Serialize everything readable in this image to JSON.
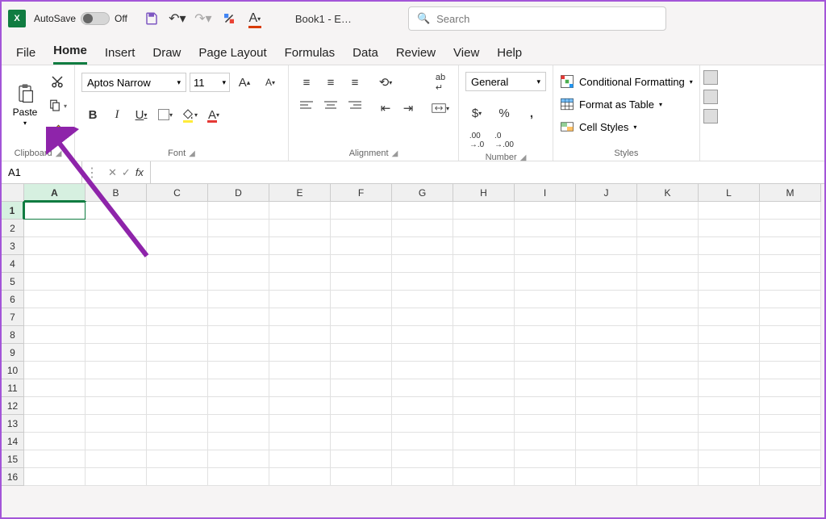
{
  "titlebar": {
    "autosave_label": "AutoSave",
    "autosave_state": "Off",
    "document_title": "Book1  -  E…",
    "search_placeholder": "Search"
  },
  "tabs": [
    "File",
    "Home",
    "Insert",
    "Draw",
    "Page Layout",
    "Formulas",
    "Data",
    "Review",
    "View",
    "Help"
  ],
  "active_tab": "Home",
  "ribbon": {
    "clipboard": {
      "label": "Clipboard",
      "paste": "Paste"
    },
    "font": {
      "label": "Font",
      "name": "Aptos Narrow",
      "size": "11"
    },
    "alignment": {
      "label": "Alignment"
    },
    "number": {
      "label": "Number",
      "format": "General"
    },
    "styles": {
      "label": "Styles",
      "conditional": "Conditional Formatting",
      "table": "Format as Table",
      "cell": "Cell Styles"
    }
  },
  "formula_bar": {
    "name_box": "A1",
    "fx": "fx"
  },
  "columns": [
    "A",
    "B",
    "C",
    "D",
    "E",
    "F",
    "G",
    "H",
    "I",
    "J",
    "K",
    "L",
    "M"
  ],
  "rows": 16,
  "active_cell": "A1"
}
